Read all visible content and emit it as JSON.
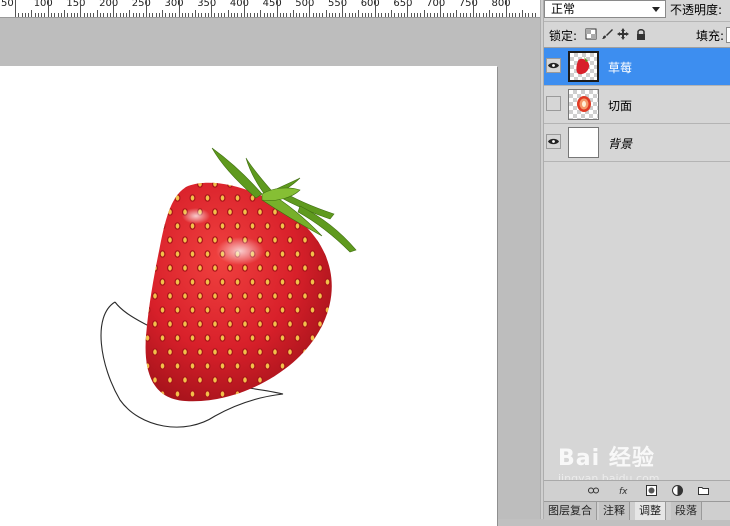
{
  "ruler": {
    "labels": [
      "50",
      "100",
      "150",
      "200",
      "250",
      "300",
      "350",
      "400",
      "450",
      "500",
      "550",
      "600",
      "650",
      "700",
      "750",
      "800"
    ]
  },
  "panel": {
    "blend_mode": "正常",
    "opacity_label": "不透明度:",
    "lock_label": "锁定:",
    "fill_label": "填充:",
    "layers": [
      {
        "name": "草莓",
        "visible": true,
        "selected": true
      },
      {
        "name": "切面",
        "visible": false,
        "selected": false
      },
      {
        "name": "背景",
        "visible": true,
        "selected": false
      }
    ],
    "tabs": [
      "图层复合",
      "注释",
      "调整",
      "段落"
    ],
    "active_tab": "调整"
  },
  "watermark": {
    "logo": "Bai 经验",
    "sub": "jingyan.baidu.com"
  },
  "colors": {
    "selection": "#3d8ef0",
    "panel_bg": "#d6d6d6",
    "canvas_bg": "#bdbdbd",
    "strawberry": "#d8202a",
    "leaves": "#5f9a1e"
  },
  "icons": [
    "eye-icon",
    "lock-transparent-icon",
    "brush-icon",
    "move-icon",
    "padlock-icon",
    "link-icon",
    "fx-icon",
    "mask-icon",
    "adjustment-icon",
    "folder-icon"
  ]
}
